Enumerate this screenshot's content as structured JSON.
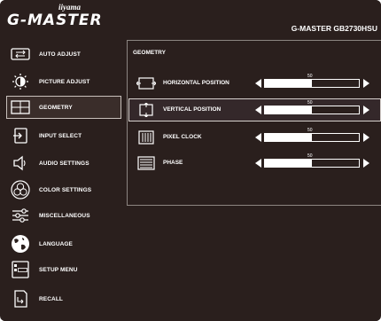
{
  "header": {
    "brand_small": "iiyama",
    "brand": "G-MASTER",
    "model": "G-MASTER GB2730HSU"
  },
  "sidebar": {
    "items": [
      {
        "label": "AUTO ADJUST",
        "icon": "auto-adjust-icon"
      },
      {
        "label": "PICTURE ADJUST",
        "icon": "brightness-icon"
      },
      {
        "label": "GEOMETRY",
        "icon": "geometry-icon",
        "selected": true
      },
      {
        "label": "INPUT SELECT",
        "icon": "input-select-icon"
      },
      {
        "label": "AUDIO SETTINGS",
        "icon": "speaker-icon"
      },
      {
        "label": "COLOR SETTINGS",
        "icon": "color-rgb-icon"
      },
      {
        "label": "MISCELLANEOUS",
        "icon": "sliders-icon"
      },
      {
        "label": "LANGUAGE",
        "icon": "globe-icon"
      },
      {
        "label": "SETUP MENU",
        "icon": "osd-icon"
      },
      {
        "label": "RECALL",
        "icon": "recall-icon"
      }
    ]
  },
  "panel": {
    "title": "GEOMETRY",
    "rows": [
      {
        "label": "HORIZONTAL POSITION",
        "icon": "horizontal-position-icon",
        "value": "50",
        "fraction": 0.5
      },
      {
        "label": "VERTICAL POSITION",
        "icon": "vertical-position-icon",
        "value": "50",
        "fraction": 0.5,
        "selected": true
      },
      {
        "label": "PIXEL CLOCK",
        "icon": "pixel-clock-icon",
        "value": "50",
        "fraction": 0.5
      },
      {
        "label": "PHASE",
        "icon": "phase-icon",
        "value": "50",
        "fraction": 0.5
      }
    ]
  },
  "colors": {
    "background": "#2a1f1d",
    "text": "#ffffff",
    "border": "#8c8581"
  }
}
